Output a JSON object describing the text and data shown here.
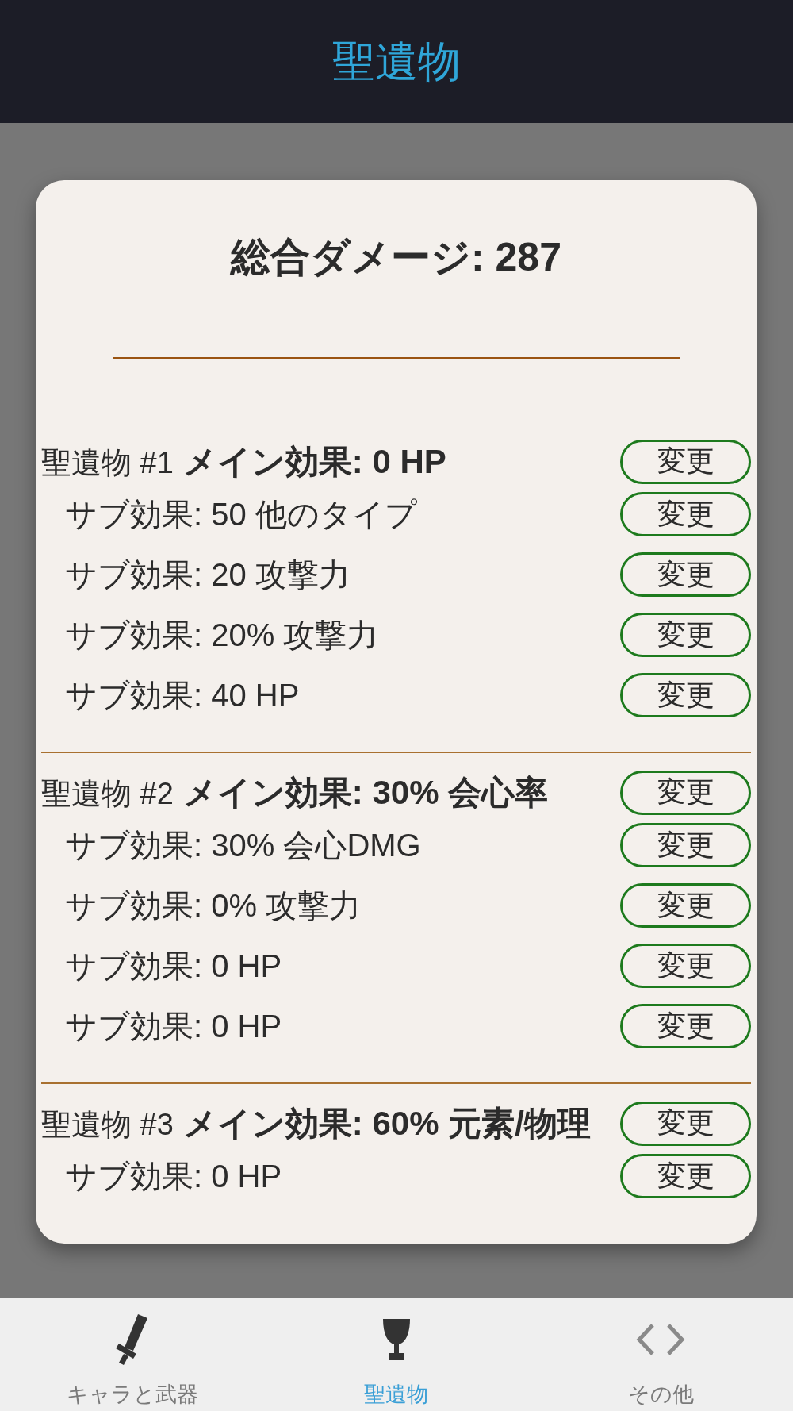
{
  "header": {
    "title": "聖遺物"
  },
  "summary": {
    "total_damage": "総合ダメージ: 287"
  },
  "artifacts": [
    {
      "label": "聖遺物 #1",
      "main_effect": {
        "text": "メイン効果: 0 HP",
        "button": "変更"
      },
      "sub_effects": [
        {
          "text": "サブ効果: 50 他のタイプ",
          "button": "変更"
        },
        {
          "text": "サブ効果: 20 攻撃力",
          "button": "変更"
        },
        {
          "text": "サブ効果: 20% 攻撃力",
          "button": "変更"
        },
        {
          "text": "サブ効果: 40 HP",
          "button": "変更"
        }
      ]
    },
    {
      "label": "聖遺物 #2",
      "main_effect": {
        "text": "メイン効果: 30% 会心率",
        "button": "変更"
      },
      "sub_effects": [
        {
          "text": "サブ効果: 30% 会心DMG",
          "button": "変更"
        },
        {
          "text": "サブ効果: 0% 攻撃力",
          "button": "変更"
        },
        {
          "text": "サブ効果: 0 HP",
          "button": "変更"
        },
        {
          "text": "サブ効果: 0 HP",
          "button": "変更"
        }
      ]
    },
    {
      "label": "聖遺物 #3",
      "main_effect": {
        "text": "メイン効果: 60% 元素/物理",
        "button": "変更"
      },
      "sub_effects": [
        {
          "text": "サブ効果: 0 HP",
          "button": "変更"
        }
      ]
    }
  ],
  "bottom_nav": {
    "tabs": [
      {
        "kind": "sword",
        "label": "キャラと武器",
        "selected": false
      },
      {
        "kind": "cup",
        "label": "聖遺物",
        "selected": true
      },
      {
        "kind": "code",
        "label": "その他",
        "selected": false
      }
    ]
  }
}
